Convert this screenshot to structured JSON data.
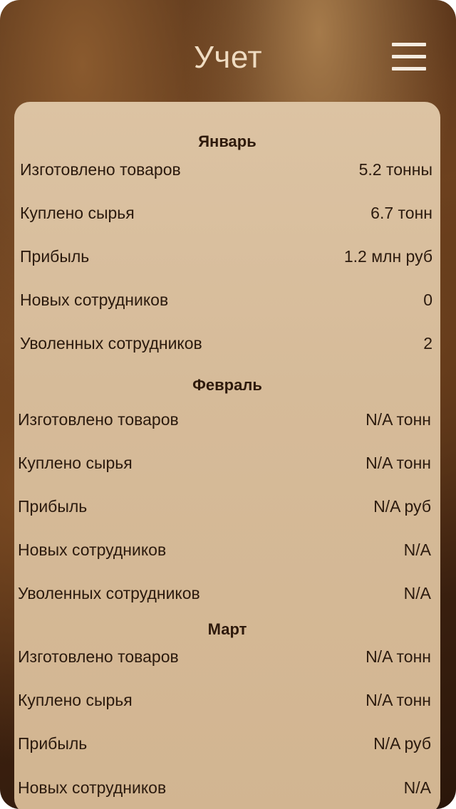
{
  "header": {
    "title": "Учет",
    "menu_icon": "hamburger-menu-icon"
  },
  "months": [
    {
      "name": "Январь",
      "rows": [
        {
          "label": "Изготовлено товаров",
          "value": "5.2 тонны"
        },
        {
          "label": "Куплено сырья",
          "value": "6.7 тонн"
        },
        {
          "label": "Прибыль",
          "value": "1.2 млн руб"
        },
        {
          "label": "Новых сотрудников",
          "value": "0"
        },
        {
          "label": "Уволенных сотрудников",
          "value": "2"
        }
      ]
    },
    {
      "name": "Февраль",
      "rows": [
        {
          "label": "Изготовлено товаров",
          "value": "N/A тонн"
        },
        {
          "label": "Куплено сырья",
          "value": "N/A тонн"
        },
        {
          "label": "Прибыль",
          "value": "N/A руб"
        },
        {
          "label": "Новых сотрудников",
          "value": "N/A"
        },
        {
          "label": "Уволенных сотрудников",
          "value": "N/A"
        }
      ]
    },
    {
      "name": "Март",
      "rows": [
        {
          "label": "Изготовлено товаров",
          "value": "N/A тонн"
        },
        {
          "label": "Куплено сырья",
          "value": "N/A тонн"
        },
        {
          "label": "Прибыль",
          "value": "N/A руб"
        },
        {
          "label": "Новых сотрудников",
          "value": "N/A"
        }
      ]
    }
  ]
}
